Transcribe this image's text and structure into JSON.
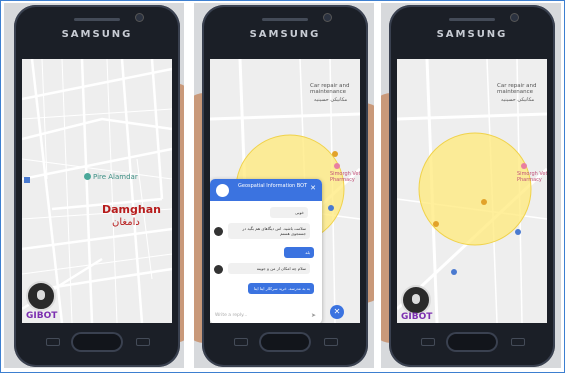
{
  "brand": "SAMSUNG",
  "panel1": {
    "city_en": "Damghan",
    "city_fa": "دامغان",
    "poi": "Pire Alamdar",
    "bot_label": "GIBOT"
  },
  "panel2": {
    "poi_title": "Car repair and maintenance",
    "poi_sub": "مکانیکی حسینیه",
    "pharmacy": "Simorgh Vet Pharmacy",
    "chat_title": "Geospatial Information BOT",
    "messages": [
      {
        "from": "bot",
        "text": "خوبی"
      },
      {
        "from": "user",
        "text": "سلامت باشید. اس دیگاهای هم بگید در جستجوی هستم"
      },
      {
        "from": "user",
        "text": "بله"
      },
      {
        "from": "bot",
        "text": "سلام چه امکان از من و جوینه"
      },
      {
        "from": "user",
        "text": "به به مدرسه. خرید سرکلار ایتا ایتا"
      }
    ],
    "input_placeholder": "Write a reply..."
  },
  "panel3": {
    "poi_title": "Car repair and maintenance",
    "poi_sub": "مکانیکی حسینیه",
    "pharmacy": "Simorgh Vet Pharmacy",
    "bot_label": "GIBOT"
  }
}
